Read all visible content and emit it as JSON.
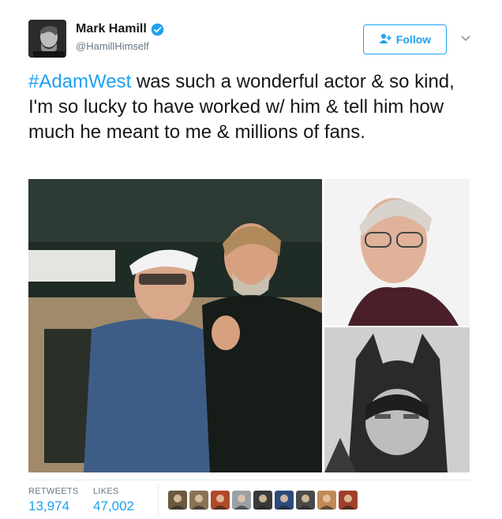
{
  "author": {
    "name": "Mark Hamill",
    "handle": "@HamillHimself",
    "verified": true,
    "avatar_icon": "profile-photo-bw"
  },
  "follow_button": {
    "label": "Follow",
    "icon": "add-user-icon",
    "color": "#1da1f2"
  },
  "menu_icon": "chevron-down-icon",
  "tweet": {
    "hashtag": "#AdamWest",
    "text": " was such a wonderful actor & so kind, I'm so lucky to have worked w/ him & tell him how much he meant to me & millions of fans."
  },
  "photos": [
    {
      "name": "photo-hamill-and-west",
      "description_icon": "photo"
    },
    {
      "name": "photo-adam-west-portrait",
      "description_icon": "photo"
    },
    {
      "name": "photo-batman-cowl",
      "description_icon": "photo"
    }
  ],
  "stats": {
    "retweets_label": "RETWEETS",
    "retweets_value": "13,974",
    "likes_label": "LIKES",
    "likes_value": "47,002"
  },
  "likers": [
    {
      "color": "#6b5a3e"
    },
    {
      "color": "#8a7355"
    },
    {
      "color": "#b04a2a"
    },
    {
      "color": "#9aa0a6"
    },
    {
      "color": "#3a3a3a"
    },
    {
      "color": "#2d4a7a"
    },
    {
      "color": "#4a4a4a"
    },
    {
      "color": "#c08a55"
    },
    {
      "color": "#a0402a"
    }
  ]
}
